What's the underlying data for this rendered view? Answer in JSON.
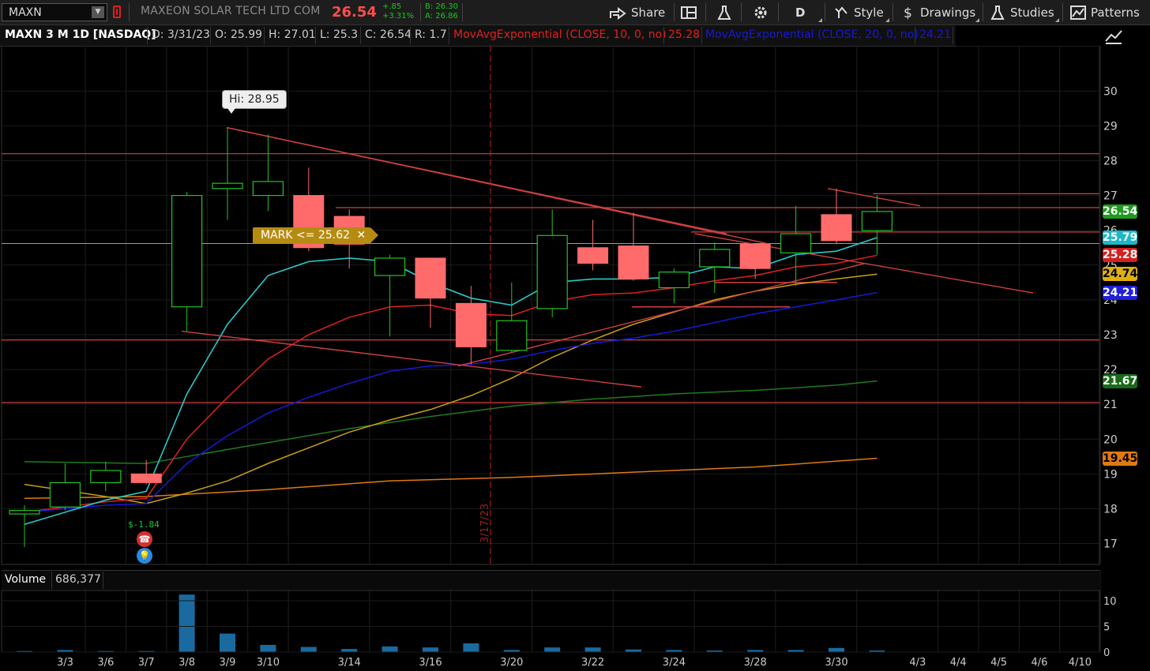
{
  "toolbar": {
    "symbol": "MAXN",
    "company": "MAXEON SOLAR TECH LTD COM",
    "last": "26.54",
    "change": "+.85",
    "change_pct": "+3.31%",
    "bid": "B: 26.30",
    "ask": "A: 26.86",
    "share_label": "Share",
    "aggregation": "D",
    "style_label": "Style",
    "drawings_label": "Drawings",
    "studies_label": "Studies",
    "patterns_label": "Patterns"
  },
  "inforow": {
    "title": "MAXN 3 M 1D [NASDAQ]",
    "date": "D: 3/31/23",
    "open": "O: 25.99",
    "high": "H: 27.01",
    "low": "L: 25.3",
    "close": "C: 26.54",
    "range": "R: 1.7",
    "ema10_label": "MovAvgExponential (CLOSE, 10, 0, no)",
    "ema10_value": "25.28",
    "ema20_label": "MovAvgExponential (CLOSE, 20, 0, no)",
    "ema20_value": "24.21"
  },
  "colors": {
    "up": "#22c322",
    "down": "#ff6b6b",
    "ema10": "#e02020",
    "ema20": "#1818d8",
    "cyan": "#28c8c8",
    "yellow": "#c8a010",
    "darkgreen": "#1f7a1f",
    "orange": "#e07a10",
    "hline": "#d04040"
  },
  "annotations": {
    "hi": "Hi: 28.95",
    "mark": "MARK <= 25.62",
    "pl": "$-1.84",
    "vline_date": "3/17/23"
  },
  "price_tags": [
    {
      "text": "26.54",
      "bg": "#1f9a1f",
      "fg": "#ffffff",
      "price": 26.54
    },
    {
      "text": "25.79",
      "bg": "#1ab8c8",
      "fg": "#ffffff",
      "price": 25.79
    },
    {
      "text": "25.28",
      "bg": "#d42020",
      "fg": "#ffffff",
      "price": 25.28
    },
    {
      "text": "24.74",
      "bg": "#e0b010",
      "fg": "#000000",
      "price": 24.74
    },
    {
      "text": "24.21",
      "bg": "#2020d8",
      "fg": "#ffffff",
      "price": 24.21
    },
    {
      "text": "21.67",
      "bg": "#1a6a1a",
      "fg": "#ffffff",
      "price": 21.67
    },
    {
      "text": "19.45",
      "bg": "#e07a10",
      "fg": "#000000",
      "price": 19.45
    }
  ],
  "volume": {
    "label": "Volume",
    "value": "686,377",
    "axis_ticks": [
      10,
      5,
      0
    ]
  },
  "chart_data": {
    "type": "candlestick",
    "ylim": [
      16.4,
      31.3
    ],
    "yticks": [
      17,
      18,
      19,
      20,
      21,
      22,
      23,
      24,
      25,
      26,
      27,
      28,
      29,
      30
    ],
    "xticks": [
      {
        "label": "3/3",
        "slot": 1
      },
      {
        "label": "3/6",
        "slot": 2
      },
      {
        "label": "3/7",
        "slot": 3
      },
      {
        "label": "3/8",
        "slot": 4
      },
      {
        "label": "3/9",
        "slot": 5
      },
      {
        "label": "3/10",
        "slot": 6
      },
      {
        "label": "3/14",
        "slot": 8
      },
      {
        "label": "3/16",
        "slot": 10
      },
      {
        "label": "3/20",
        "slot": 12
      },
      {
        "label": "3/22",
        "slot": 14
      },
      {
        "label": "3/24",
        "slot": 16
      },
      {
        "label": "3/28",
        "slot": 18
      },
      {
        "label": "3/30",
        "slot": 20
      },
      {
        "label": "4/3",
        "slot": 22
      },
      {
        "label": "4/4",
        "slot": 23
      },
      {
        "label": "4/5",
        "slot": 24
      },
      {
        "label": "4/6",
        "slot": 25
      },
      {
        "label": "4/10",
        "slot": 26
      }
    ],
    "candles": [
      {
        "slot": 0,
        "o": 17.85,
        "h": 18.1,
        "l": 16.9,
        "c": 17.95
      },
      {
        "slot": 1,
        "o": 18.05,
        "h": 19.3,
        "l": 17.95,
        "c": 18.75
      },
      {
        "slot": 2,
        "o": 18.75,
        "h": 19.35,
        "l": 18.5,
        "c": 19.1
      },
      {
        "slot": 3,
        "o": 19.0,
        "h": 19.4,
        "l": 18.7,
        "c": 18.75
      },
      {
        "slot": 4,
        "o": 23.8,
        "h": 27.1,
        "l": 23.1,
        "c": 27.0
      },
      {
        "slot": 5,
        "o": 27.2,
        "h": 28.95,
        "l": 26.3,
        "c": 27.35
      },
      {
        "slot": 6,
        "o": 27.0,
        "h": 28.75,
        "l": 26.55,
        "c": 27.4
      },
      {
        "slot": 7,
        "o": 27.0,
        "h": 27.8,
        "l": 25.4,
        "c": 25.5
      },
      {
        "slot": 8,
        "o": 26.4,
        "h": 26.6,
        "l": 24.9,
        "c": 25.6
      },
      {
        "slot": 9,
        "o": 24.7,
        "h": 25.3,
        "l": 22.95,
        "c": 25.2
      },
      {
        "slot": 10,
        "o": 25.2,
        "h": 25.2,
        "l": 23.2,
        "c": 24.05
      },
      {
        "slot": 11,
        "o": 23.9,
        "h": 24.4,
        "l": 22.15,
        "c": 22.65
      },
      {
        "slot": 12,
        "o": 22.55,
        "h": 24.5,
        "l": 22.5,
        "c": 23.4
      },
      {
        "slot": 13,
        "o": 23.75,
        "h": 26.6,
        "l": 23.5,
        "c": 25.85
      },
      {
        "slot": 14,
        "o": 25.5,
        "h": 26.3,
        "l": 24.85,
        "c": 25.05
      },
      {
        "slot": 15,
        "o": 25.55,
        "h": 26.5,
        "l": 24.55,
        "c": 24.6
      },
      {
        "slot": 16,
        "o": 24.35,
        "h": 24.9,
        "l": 23.9,
        "c": 24.8
      },
      {
        "slot": 17,
        "o": 24.95,
        "h": 25.65,
        "l": 24.2,
        "c": 25.45
      },
      {
        "slot": 18,
        "o": 25.6,
        "h": 25.6,
        "l": 24.6,
        "c": 24.9
      },
      {
        "slot": 19,
        "o": 25.35,
        "h": 26.7,
        "l": 24.4,
        "c": 25.9
      },
      {
        "slot": 20,
        "o": 26.45,
        "h": 27.2,
        "l": 25.6,
        "c": 25.7
      },
      {
        "slot": 21,
        "o": 25.99,
        "h": 27.01,
        "l": 25.3,
        "c": 26.54
      }
    ],
    "series": [
      {
        "name": "MovAvgExponential (CLOSE, 10, 0, no)",
        "color": "#e02020",
        "values": [
          17.9,
          18.05,
          18.2,
          18.3,
          20.0,
          21.2,
          22.3,
          23.0,
          23.5,
          23.8,
          23.85,
          23.6,
          23.55,
          23.95,
          24.15,
          24.2,
          24.35,
          24.55,
          24.7,
          24.95,
          25.05,
          25.28
        ]
      },
      {
        "name": "MovAvgExponential (CLOSE, 20, 0, no)",
        "color": "#1818d8",
        "values": [
          17.9,
          18.0,
          18.1,
          18.15,
          19.3,
          20.1,
          20.75,
          21.2,
          21.6,
          21.95,
          22.1,
          22.15,
          22.3,
          22.55,
          22.75,
          22.9,
          23.1,
          23.35,
          23.6,
          23.8,
          24.0,
          24.21
        ]
      }
    ],
    "volume_bars": [
      0.2,
      0.4,
      0.2,
      0.2,
      11.2,
      3.6,
      1.4,
      1.0,
      0.6,
      1.1,
      0.9,
      1.7,
      0.4,
      0.9,
      0.9,
      0.5,
      0.4,
      0.3,
      0.4,
      0.4,
      0.8,
      0.3
    ],
    "volume_ylim": [
      0,
      12
    ]
  }
}
